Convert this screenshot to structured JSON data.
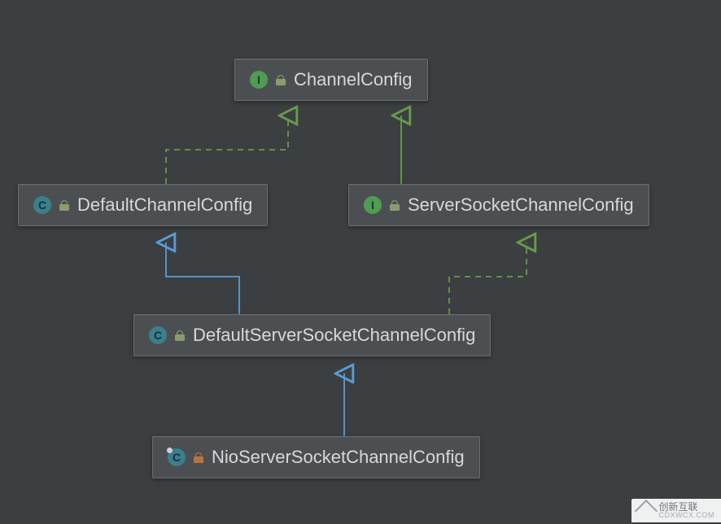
{
  "chart_data": {
    "type": "uml_class_hierarchy",
    "nodes": [
      {
        "id": "ChannelConfig",
        "kind": "interface",
        "visibility": "package",
        "static": false
      },
      {
        "id": "DefaultChannelConfig",
        "kind": "class",
        "visibility": "package",
        "static": false
      },
      {
        "id": "ServerSocketChannelConfig",
        "kind": "interface",
        "visibility": "package",
        "static": false
      },
      {
        "id": "DefaultServerSocketChannelConfig",
        "kind": "class",
        "visibility": "package",
        "static": false
      },
      {
        "id": "NioServerSocketChannelConfig",
        "kind": "class",
        "visibility": "private",
        "static": true
      }
    ],
    "edges": [
      {
        "from": "DefaultChannelConfig",
        "to": "ChannelConfig",
        "relation": "implements"
      },
      {
        "from": "ServerSocketChannelConfig",
        "to": "ChannelConfig",
        "relation": "extends_interface"
      },
      {
        "from": "DefaultServerSocketChannelConfig",
        "to": "DefaultChannelConfig",
        "relation": "extends"
      },
      {
        "from": "DefaultServerSocketChannelConfig",
        "to": "ServerSocketChannelConfig",
        "relation": "implements"
      },
      {
        "from": "NioServerSocketChannelConfig",
        "to": "DefaultServerSocketChannelConfig",
        "relation": "extends"
      }
    ]
  },
  "nodes": {
    "n1": {
      "label": "ChannelConfig",
      "type_letter": "I"
    },
    "n2": {
      "label": "DefaultChannelConfig",
      "type_letter": "C"
    },
    "n3": {
      "label": "ServerSocketChannelConfig",
      "type_letter": "I"
    },
    "n4": {
      "label": "DefaultServerSocketChannelConfig",
      "type_letter": "C"
    },
    "n5": {
      "label": "NioServerSocketChannelConfig",
      "type_letter": "C"
    }
  },
  "colors": {
    "extends_line": "#5b9bd5",
    "implements_line": "#6a994e",
    "interface_badge": "#4f9c54",
    "class_badge": "#3c7f8c"
  },
  "watermark": {
    "line1": "创新互联",
    "line2": "CDXWCX.COM"
  }
}
